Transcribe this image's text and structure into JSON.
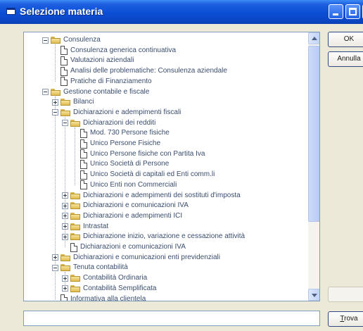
{
  "window": {
    "title": "Selezione materia"
  },
  "tree": {
    "items": [
      {
        "label": "Consulenza",
        "type": "folder",
        "level": 0,
        "expander": "minus"
      },
      {
        "label": "Consulenza generica continuativa",
        "type": "doc",
        "level": 1
      },
      {
        "label": "Valutazioni aziendali",
        "type": "doc",
        "level": 1
      },
      {
        "label": "Analisi delle problematiche: Consulenza aziendale",
        "type": "doc",
        "level": 1
      },
      {
        "label": "Pratiche di Finanziamento",
        "type": "doc",
        "level": 1
      },
      {
        "label": "Gestione contabile e fiscale",
        "type": "folder",
        "level": 0,
        "expander": "minus"
      },
      {
        "label": "Bilanci",
        "type": "folder",
        "level": 1,
        "expander": "plus"
      },
      {
        "label": "Dichiarazioni e adempimenti fiscali",
        "type": "folder",
        "level": 1,
        "expander": "minus"
      },
      {
        "label": "Dichiarazioni dei redditi",
        "type": "folder",
        "level": 2,
        "expander": "minus"
      },
      {
        "label": "Mod. 730 Persone fisiche",
        "type": "doc",
        "level": 3
      },
      {
        "label": "Unico Persone Fisiche",
        "type": "doc",
        "level": 3
      },
      {
        "label": "Unico Persone fisiche con Partita Iva",
        "type": "doc",
        "level": 3
      },
      {
        "label": "Unico Società di Persone",
        "type": "doc",
        "level": 3
      },
      {
        "label": "Unico Società di capitali ed Enti comm.li",
        "type": "doc",
        "level": 3
      },
      {
        "label": "Unico Enti non Commerciali",
        "type": "doc",
        "level": 3
      },
      {
        "label": "Dichiarazioni e adempimenti dei sostituti d'imposta",
        "type": "folder",
        "level": 2,
        "expander": "plus"
      },
      {
        "label": "Dichiarazioni e comunicazioni IVA",
        "type": "folder",
        "level": 2,
        "expander": "plus"
      },
      {
        "label": "Dichiarazioni e adempimenti ICI",
        "type": "folder",
        "level": 2,
        "expander": "plus"
      },
      {
        "label": "Intrastat",
        "type": "folder",
        "level": 2,
        "expander": "plus"
      },
      {
        "label": "Dichiarazione inizio, variazione e cessazione attività",
        "type": "folder",
        "level": 2,
        "expander": "plus"
      },
      {
        "label": "Dichiarazioni e comunicazioni IVA",
        "type": "doc",
        "level": 2
      },
      {
        "label": "Dichiarazioni e comunicazioni enti previdenziali",
        "type": "folder",
        "level": 1,
        "expander": "plus"
      },
      {
        "label": "Tenuta contabilità",
        "type": "folder",
        "level": 1,
        "expander": "minus"
      },
      {
        "label": "Contabilità Ordinaria",
        "type": "folder",
        "level": 2,
        "expander": "plus"
      },
      {
        "label": "Contabilità Semplificata",
        "type": "folder",
        "level": 2,
        "expander": "plus"
      },
      {
        "label": "Informativa alla clientela",
        "type": "doc",
        "level": 1
      }
    ]
  },
  "buttons": {
    "ok": "OK",
    "annulla": "Annulla",
    "disabled": "",
    "trova_accel": "T",
    "trova_rest": "rova"
  },
  "search": {
    "value": ""
  }
}
